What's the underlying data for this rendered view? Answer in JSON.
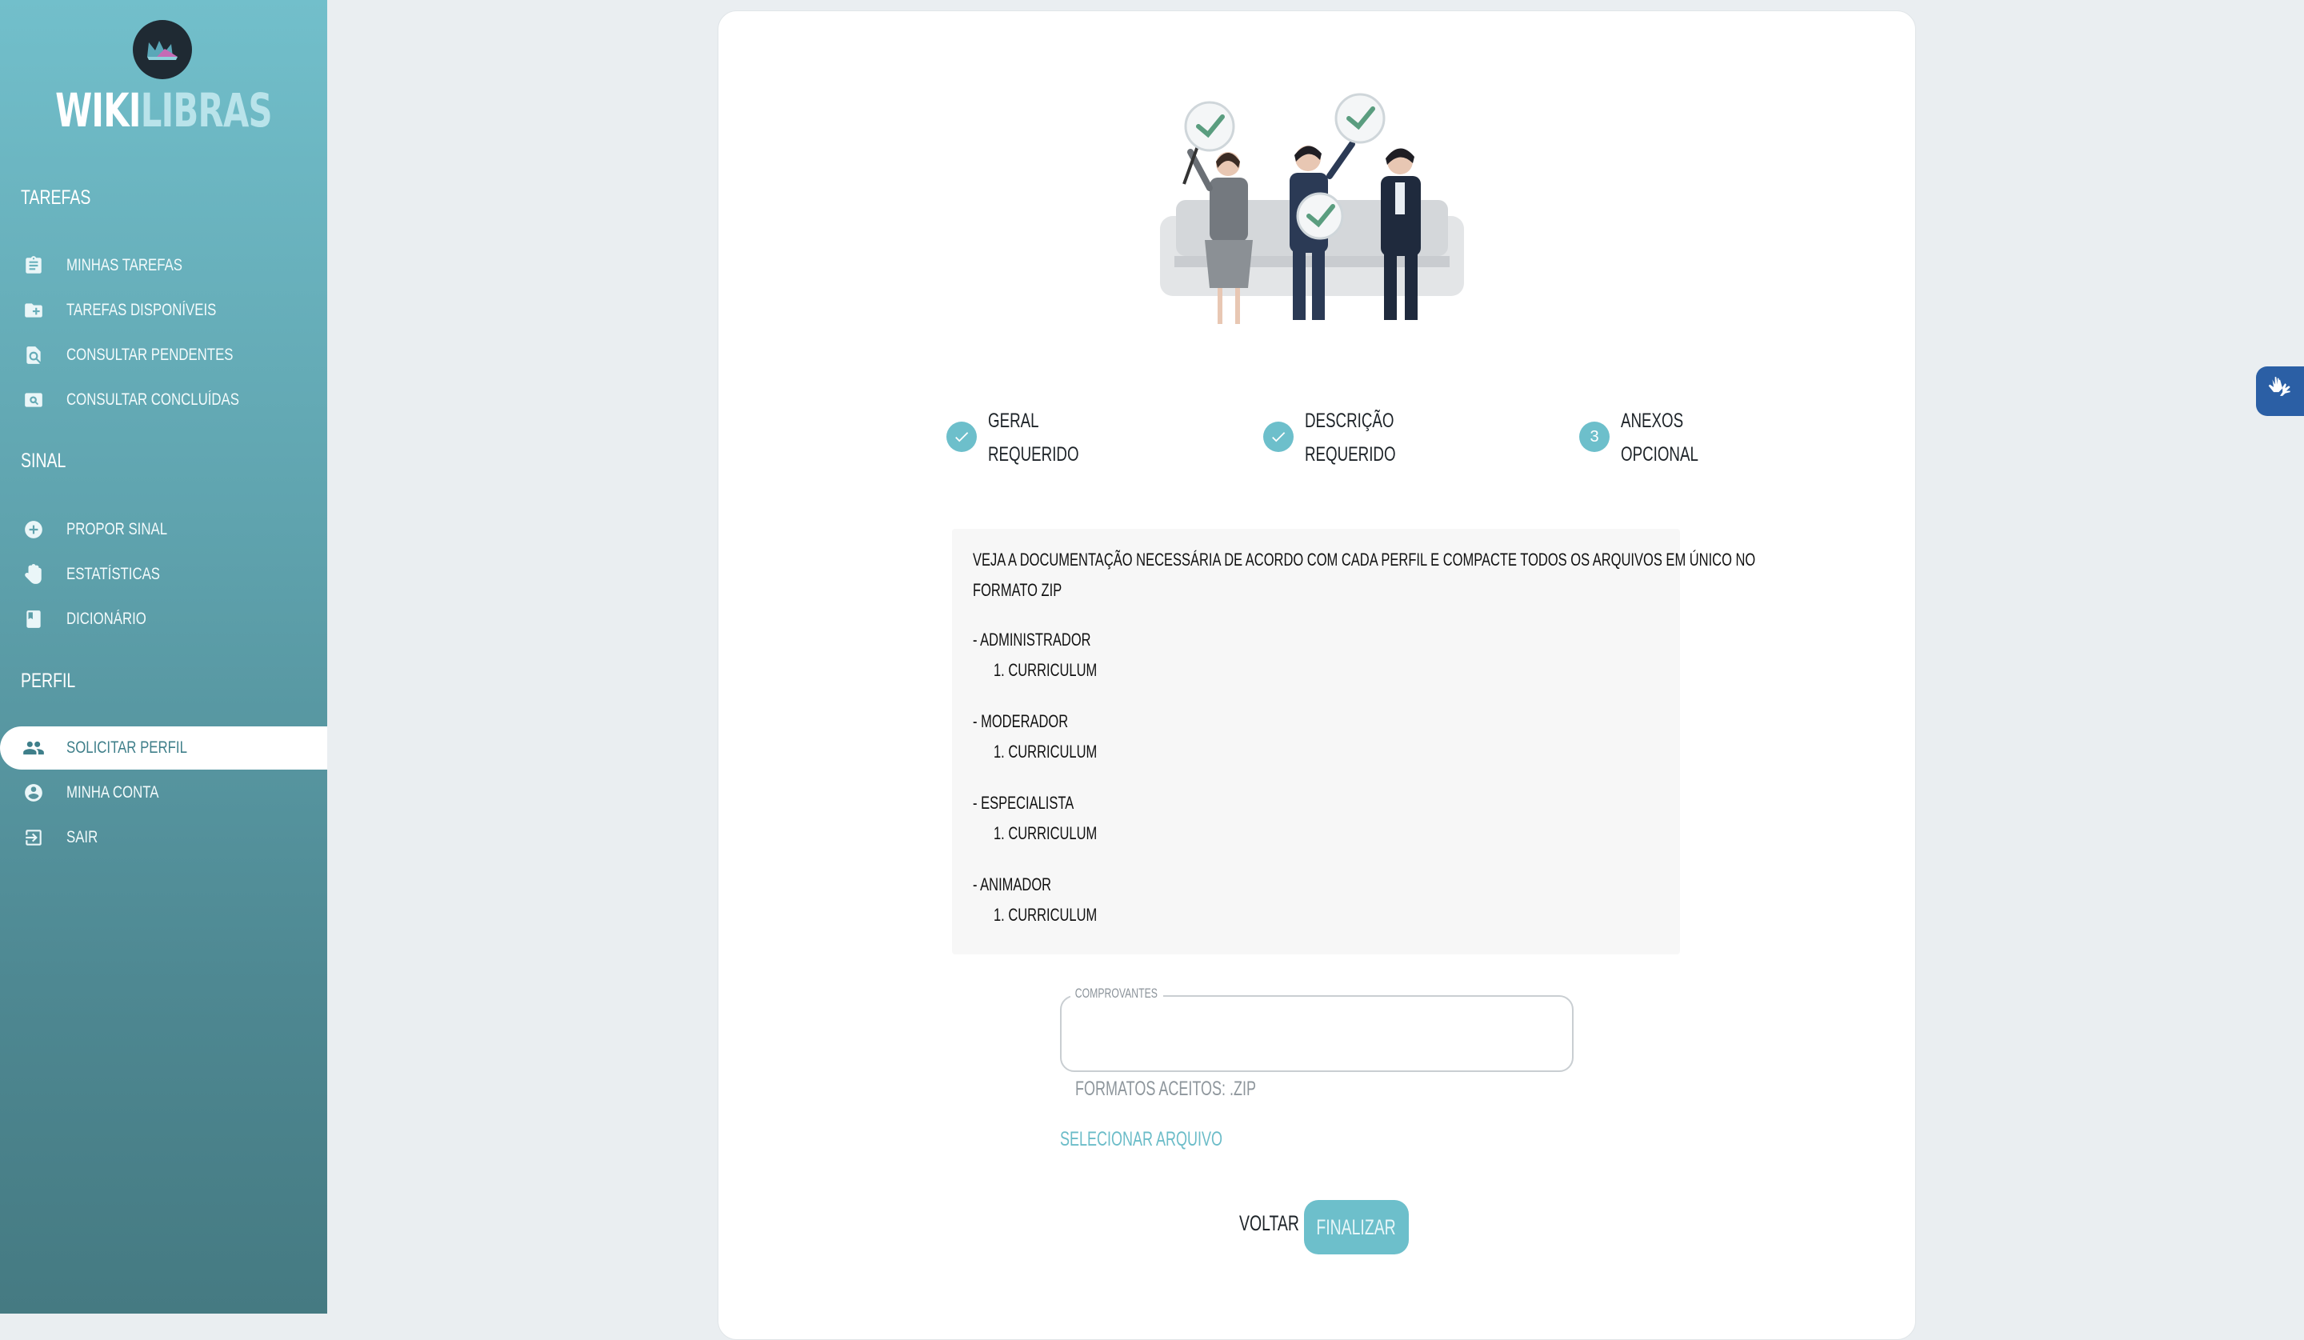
{
  "brand": {
    "name_bold": "WIKI",
    "name_light": "LIBRAS",
    "logo_icon": "crown-logo-icon"
  },
  "sidebar": {
    "sections": [
      {
        "title": "Tarefas",
        "items": [
          {
            "label": "Minhas Tarefas",
            "icon": "assignment-icon"
          },
          {
            "label": "Tarefas Disponíveis",
            "icon": "folder-add-icon"
          },
          {
            "label": "Consultar Pendentes",
            "icon": "find-in-page-icon"
          },
          {
            "label": "Consultar Concluídas",
            "icon": "image-search-icon"
          }
        ]
      },
      {
        "title": "Sinal",
        "items": [
          {
            "label": "Propor Sinal",
            "icon": "add-circle-icon"
          },
          {
            "label": "Estatísticas",
            "icon": "hand-icon"
          },
          {
            "label": "Dicionário",
            "icon": "book-icon"
          }
        ]
      },
      {
        "title": "Perfil",
        "items": [
          {
            "label": "Solicitar Perfil",
            "icon": "people-icon",
            "active": true
          },
          {
            "label": "Minha Conta",
            "icon": "account-circle-icon"
          },
          {
            "label": "Sair",
            "icon": "logout-icon"
          }
        ]
      }
    ]
  },
  "stepper": [
    {
      "title": "Geral",
      "subtitle": "Requerido",
      "state": "done",
      "number": ""
    },
    {
      "title": "Descrição",
      "subtitle": "Requerido",
      "state": "done",
      "number": ""
    },
    {
      "title": "Anexos",
      "subtitle": "Opcional",
      "state": "current",
      "number": "3"
    }
  ],
  "instructions": {
    "intro_line1": "Veja a documentação necessária de acordo com cada perfil e compacte todos os arquivos em único no",
    "intro_line2": "formato ZIP",
    "profiles": [
      {
        "name": "- Administrador",
        "doc": "1. Curriculum"
      },
      {
        "name": "- Moderador",
        "doc": "1. Curriculum"
      },
      {
        "name": "- Especialista",
        "doc": "1. Curriculum"
      },
      {
        "name": "- Animador",
        "doc": "1. Curriculum"
      }
    ]
  },
  "upload": {
    "legend": "Comprovantes",
    "value": "",
    "helper": "Formatos aceitos: .zip",
    "select_label": "Selecionar arquivo"
  },
  "actions": {
    "back": "Voltar",
    "finish": "Finalizar"
  },
  "colors": {
    "accent": "#6dbfcb",
    "sidebar_top": "#72bfcb",
    "sidebar_bottom": "#457a82",
    "vlibras": "#2b5fa5"
  }
}
